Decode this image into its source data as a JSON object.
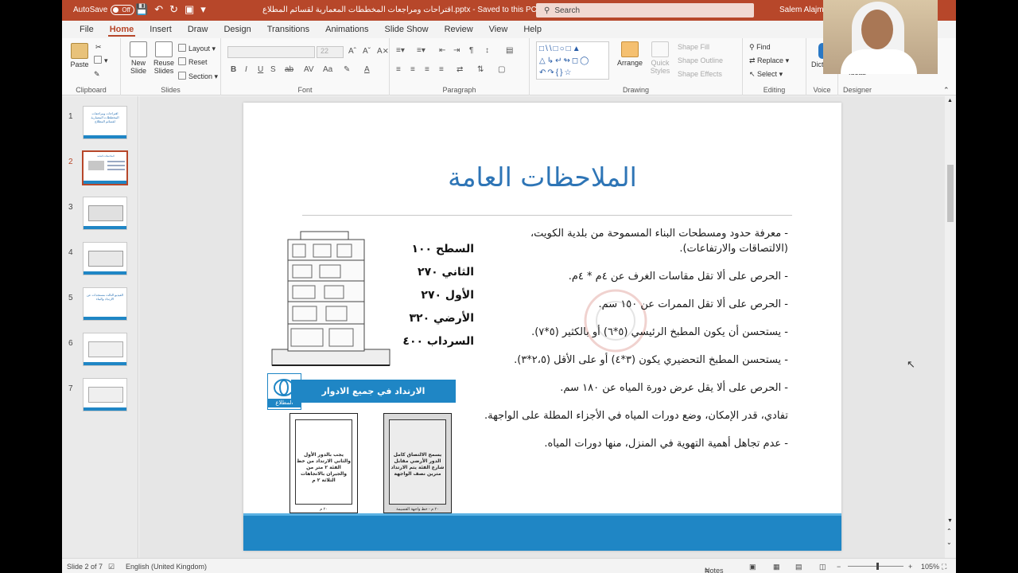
{
  "titlebar": {
    "autosave_label": "AutoSave",
    "autosave_state": "Off",
    "title": "اقتراحات ومراجعات المخططات المعمارية لقسائم المطلاع.pptx - Saved to this PC",
    "search_placeholder": "Search",
    "user": "Salem Alajmi"
  },
  "menu": [
    "File",
    "Home",
    "Insert",
    "Draw",
    "Design",
    "Transitions",
    "Animations",
    "Slide Show",
    "Review",
    "View",
    "Help"
  ],
  "ribbon": {
    "clipboard": {
      "paste": "Paste",
      "label": "Clipboard"
    },
    "slides": {
      "new_slide": "New Slide",
      "reuse": "Reuse Slides",
      "layout": "Layout",
      "reset": "Reset",
      "section": "Section",
      "label": "Slides"
    },
    "font": {
      "size": "22",
      "label": "Font",
      "bold": "B",
      "italic": "I",
      "underline": "U",
      "strike": "S"
    },
    "paragraph": {
      "label": "Paragraph"
    },
    "drawing": {
      "arrange": "Arrange",
      "quick_styles": "Quick Styles",
      "shape_fill": "Shape Fill",
      "shape_outline": "Shape Outline",
      "shape_effects": "Shape Effects",
      "label": "Drawing"
    },
    "editing": {
      "find": "Find",
      "replace": "Replace",
      "select": "Select",
      "label": "Editing"
    },
    "voice": {
      "dictate": "Dictate",
      "label": "Voice"
    },
    "designer": {
      "ideas": "Ideas",
      "label": "Designer"
    }
  },
  "thumbnails": [
    {
      "num": "1",
      "caption": "اقتراحات ومراجعات المخططات المعمارية لقسائم المطلاع"
    },
    {
      "num": "2",
      "caption": "الملاحظات العامة"
    },
    {
      "num": "3",
      "caption": ""
    },
    {
      "num": "4",
      "caption": ""
    },
    {
      "num": "5",
      "caption": "الفيديو الثالث مستجدات عن الارتداد والبناء"
    },
    {
      "num": "6",
      "caption": ""
    },
    {
      "num": "7",
      "caption": ""
    }
  ],
  "slide": {
    "title": "الملاحظات العامة",
    "bullets": [
      "- معرفة حدود ومسطحات البناء المسموحة من بلدية الكويت، (الالتصاقات والارتفاعات).",
      "- الحرص على ألا تقل مقاسات الغرف عن ٤م * ٤م.",
      "- الحرص على ألا تقل الممرات عن ١٥٠ سم.",
      "- يستحسن أن يكون المطبخ الرئيسي (٥*٦) أو بالكثير (٥*٧).",
      "- يستحسن المطبخ التحضيري يكون (٣*٤) أو على الأقل (٢،٥*٣).",
      "- الحرص على ألا يقل عرض دورة المياه عن ١٨٠ سم.",
      "تفادي، قدر الإمكان، وضع دورات المياه في الأجزاء المطلة على الواجهة.",
      "- عدم تجاهل أهمية التهوية في المنزل، منها دورات المياه."
    ],
    "elevations": [
      "السطح ١٠٠",
      "الثاني ٢٧٠",
      "الأول ٢٧٠",
      "الأرضي ٣٢٠",
      "السرداب ٤٠٠"
    ],
    "banner": "الارتداد في جميع الادوار",
    "logo_text": "المطلاع",
    "plan_left_text": "يجب بالدور الأول والثاني الارتداد من خط الفئة ٢ متر من والجيران بالاتجاهات الثلاثة ٢ م",
    "plan_left_caption": "٢٠ م",
    "plan_right_text": "يسمح الالتصاق كامل الدور الأرضي مقابل شارع الفئة يتم الارتداد مترين نصف الواجهة",
    "plan_right_caption": "٢٠ م - خط واجهة القسيمة"
  },
  "status": {
    "slide_info": "Slide 2 of 7",
    "language": "English (United Kingdom)",
    "notes": "Notes",
    "zoom": "105%"
  }
}
